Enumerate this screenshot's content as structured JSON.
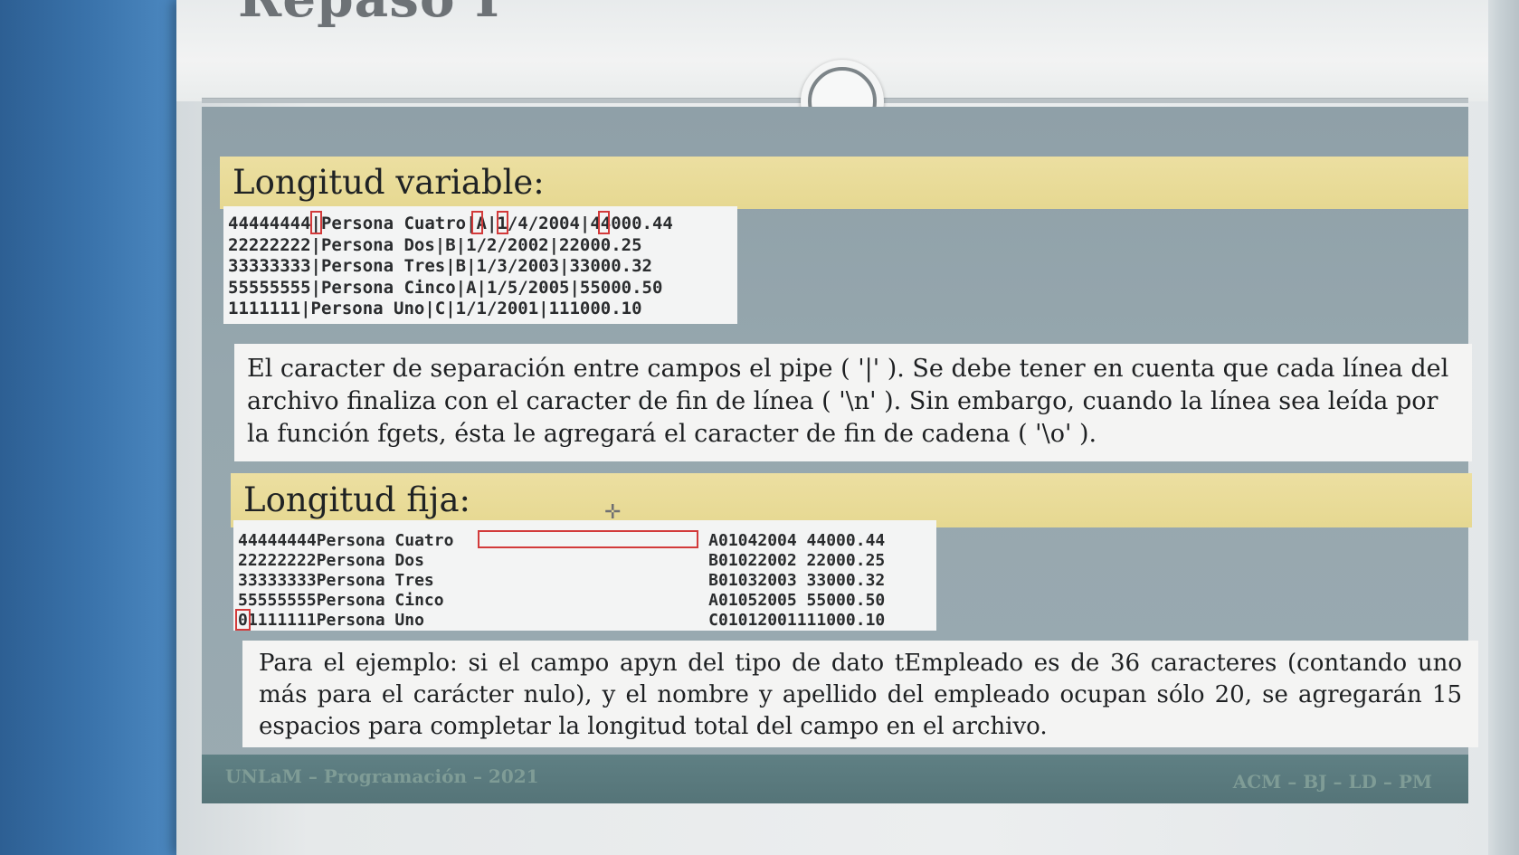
{
  "slide": {
    "title": "Repaso I",
    "variable_section": {
      "heading": "Longitud variable:",
      "lines": [
        "44444444|Persona Cuatro|A|1/4/2004|44000.44",
        "22222222|Persona Dos|B|1/2/2002|22000.25",
        "33333333|Persona Tres|B|1/3/2003|33000.32",
        "55555555|Persona Cinco|A|1/5/2005|55000.50",
        "1111111|Persona Uno|C|1/1/2001|111000.10"
      ],
      "explanation": "El caracter de separación entre campos el pipe ( '|' ). Se debe tener en cuenta que cada línea del archivo finaliza con el caracter de fin de línea ( '\\n' ). Sin embargo, cuando la línea sea leída por la función fgets, ésta le agregará el caracter de fin de cadena ( '\\o' )."
    },
    "fixed_section": {
      "heading": "Longitud fija:",
      "lines": [
        "44444444Persona Cuatro                          A01042004 44000.44",
        "22222222Persona Dos                             B01022002 22000.25",
        "33333333Persona Tres                            B01032003 33000.32",
        "55555555Persona Cinco                           A01052005 55000.50",
        "01111111Persona Uno                             C01012001111000.10"
      ],
      "explanation": "Para el ejemplo: si el campo apyn del tipo de dato tEmpleado es de 36 caracteres (contando uno más para el carácter nulo), y el nombre y apellido del  empleado ocupan sólo 20, se agregarán 15 espacios para completar la longitud total del campo en el archivo."
    },
    "footer": {
      "left": "UNLaM – Programación – 2021",
      "right": "ACM – BJ – LD – PM"
    }
  },
  "colors": {
    "band": "#e6d891",
    "highlight": "#d23a3a",
    "footer": "#557478",
    "background": "#3a73ab"
  }
}
